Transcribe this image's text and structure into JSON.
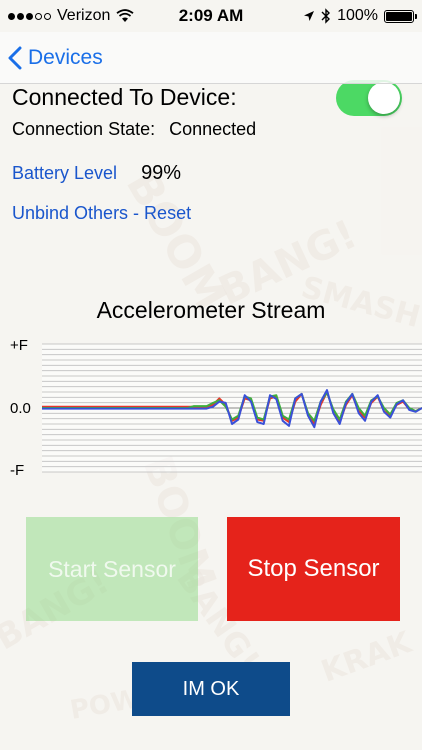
{
  "status_bar": {
    "carrier": "Verizon",
    "time": "2:09 AM",
    "battery_percent_label": "100%",
    "signal_bars_filled": 3,
    "signal_bars_total": 5
  },
  "nav": {
    "back_label": "Devices"
  },
  "device": {
    "connected_title": "Connected To Device:",
    "toggle_on": true,
    "connection_state_label": "Connection State:",
    "connection_state_value": "Connected",
    "battery_label": "Battery Level",
    "battery_value": "99%",
    "unbind_label": "Unbind Others - Reset"
  },
  "chart": {
    "title": "Accelerometer Stream",
    "y_top_label": "+F",
    "y_mid_label": "0.0",
    "y_bottom_label": "-F"
  },
  "chart_data": {
    "type": "line",
    "title": "Accelerometer Stream",
    "ylim": [
      -1,
      1
    ],
    "grid": true,
    "x": [
      0,
      1,
      2,
      3,
      4,
      5,
      6,
      7,
      8,
      9,
      10,
      11,
      12,
      13,
      14,
      15,
      16,
      17,
      18,
      19,
      20,
      21,
      22,
      23,
      24,
      25,
      26,
      27,
      28,
      29,
      30,
      31,
      32,
      33,
      34,
      35,
      36,
      37,
      38,
      39,
      40,
      41,
      42,
      43,
      44,
      45,
      46,
      47,
      48,
      49,
      50,
      51,
      52,
      53,
      54,
      55,
      56,
      57,
      58,
      59,
      60
    ],
    "series": [
      {
        "color": "#e8342a",
        "values": [
          0.02,
          0.02,
          0.02,
          0.02,
          0.02,
          0.02,
          0.02,
          0.02,
          0.02,
          0.02,
          0.02,
          0.02,
          0.02,
          0.02,
          0.02,
          0.02,
          0.02,
          0.02,
          0.02,
          0.02,
          0.02,
          0.02,
          0.02,
          0.02,
          0.02,
          0.02,
          0.02,
          0.05,
          0.15,
          0.05,
          -0.2,
          -0.15,
          0.15,
          0.12,
          -0.18,
          -0.2,
          0.15,
          0.18,
          -0.15,
          -0.22,
          0.1,
          0.22,
          -0.1,
          -0.25,
          0.05,
          0.25,
          -0.05,
          -0.22,
          0.05,
          0.2,
          -0.05,
          -0.15,
          0.08,
          0.18,
          -0.05,
          -0.12,
          0.05,
          0.1,
          -0.02,
          -0.05,
          0.0
        ]
      },
      {
        "color": "#3fae3c",
        "values": [
          0.0,
          0.0,
          0.0,
          0.0,
          0.0,
          0.0,
          0.0,
          0.0,
          0.0,
          0.0,
          0.0,
          0.0,
          0.0,
          0.0,
          0.0,
          0.0,
          0.0,
          0.0,
          0.0,
          0.0,
          0.0,
          0.0,
          0.0,
          0.0,
          0.03,
          0.03,
          0.03,
          0.08,
          0.12,
          0.02,
          -0.18,
          -0.12,
          0.18,
          0.15,
          -0.15,
          -0.18,
          0.18,
          0.2,
          -0.12,
          -0.18,
          0.15,
          0.22,
          -0.08,
          -0.2,
          0.1,
          0.24,
          -0.02,
          -0.18,
          0.1,
          0.22,
          0.0,
          -0.12,
          0.12,
          0.18,
          0.0,
          -0.1,
          0.08,
          0.12,
          0.0,
          -0.05,
          0.0
        ]
      },
      {
        "color": "#3a50d8",
        "values": [
          -0.01,
          -0.01,
          -0.01,
          -0.01,
          -0.01,
          -0.01,
          -0.01,
          -0.01,
          -0.01,
          -0.01,
          -0.01,
          -0.01,
          -0.01,
          -0.01,
          -0.01,
          -0.01,
          -0.01,
          -0.01,
          -0.01,
          -0.01,
          -0.01,
          -0.01,
          -0.01,
          -0.01,
          -0.01,
          -0.01,
          -0.01,
          0.02,
          0.1,
          0.08,
          -0.25,
          -0.18,
          0.2,
          0.1,
          -0.22,
          -0.25,
          0.2,
          0.14,
          -0.2,
          -0.28,
          0.15,
          0.22,
          -0.12,
          -0.3,
          0.1,
          0.28,
          -0.08,
          -0.25,
          0.08,
          0.22,
          -0.08,
          -0.2,
          0.1,
          0.2,
          -0.06,
          -0.15,
          0.06,
          0.12,
          -0.03,
          -0.06,
          0.0
        ]
      }
    ]
  },
  "buttons": {
    "start_label": "Start Sensor",
    "stop_label": "Stop Sensor",
    "ok_label": "IM OK"
  },
  "colors": {
    "accent_link": "#1a56cc",
    "toggle_on": "#4cd964",
    "stop_button": "#e5231b",
    "ok_button": "#0e4b8a"
  }
}
